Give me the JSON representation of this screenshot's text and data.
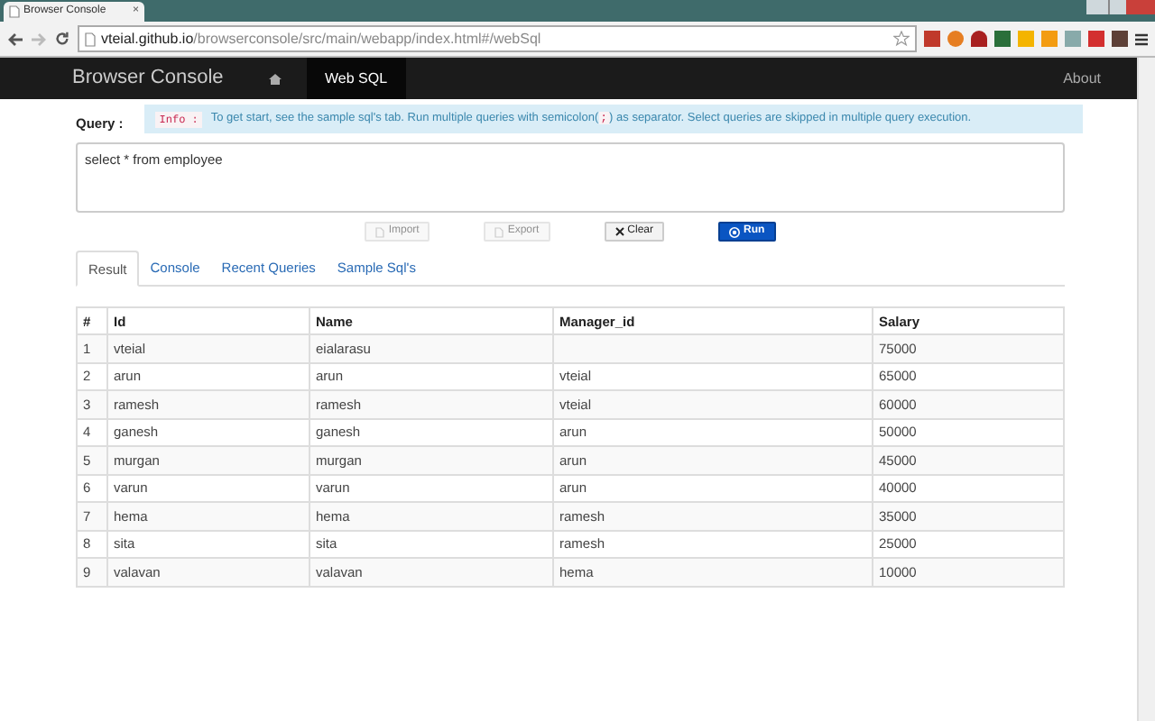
{
  "browser": {
    "tab_title": "Browser Console",
    "tab_close": "×",
    "url_host": "vteial.github.io",
    "url_path": "/browserconsole/src/main/webapp/index.html#/webSql"
  },
  "navbar": {
    "brand": "Browser Console",
    "items": [
      {
        "label": "Web SQL",
        "selected": true
      }
    ],
    "right": "About"
  },
  "query": {
    "label": "Query :",
    "info_badge": "Info :",
    "info_before": "To get start, see the sample sql's tab. Run multiple queries with semicolon(",
    "info_code": ";",
    "info_after": ") as separator. Select queries are skipped in multiple query execution.",
    "value": "select * from employee"
  },
  "buttons": [
    {
      "label": "Import",
      "kind": "import",
      "disabled": true
    },
    {
      "label": "Export",
      "kind": "export",
      "disabled": true
    },
    {
      "label": "Clear",
      "kind": "clear",
      "disabled": false
    },
    {
      "label": "Run",
      "kind": "run",
      "disabled": false
    }
  ],
  "tabs": [
    {
      "label": "Result",
      "selected": true
    },
    {
      "label": "Console",
      "selected": false
    },
    {
      "label": "Recent Queries",
      "selected": false
    },
    {
      "label": "Sample Sql's",
      "selected": false
    }
  ],
  "table": {
    "columns": [
      "#",
      "Id",
      "Name",
      "Manager_id",
      "Salary"
    ],
    "rows": [
      [
        "1",
        "vteial",
        "eialarasu",
        "",
        "75000"
      ],
      [
        "2",
        "arun",
        "arun",
        "vteial",
        "65000"
      ],
      [
        "3",
        "ramesh",
        "ramesh",
        "vteial",
        "60000"
      ],
      [
        "4",
        "ganesh",
        "ganesh",
        "arun",
        "50000"
      ],
      [
        "5",
        "murgan",
        "murgan",
        "arun",
        "45000"
      ],
      [
        "6",
        "varun",
        "varun",
        "arun",
        "40000"
      ],
      [
        "7",
        "hema",
        "hema",
        "ramesh",
        "35000"
      ],
      [
        "8",
        "sita",
        "sita",
        "ramesh",
        "25000"
      ],
      [
        "9",
        "valavan",
        "valavan",
        "hema",
        "10000"
      ]
    ]
  }
}
